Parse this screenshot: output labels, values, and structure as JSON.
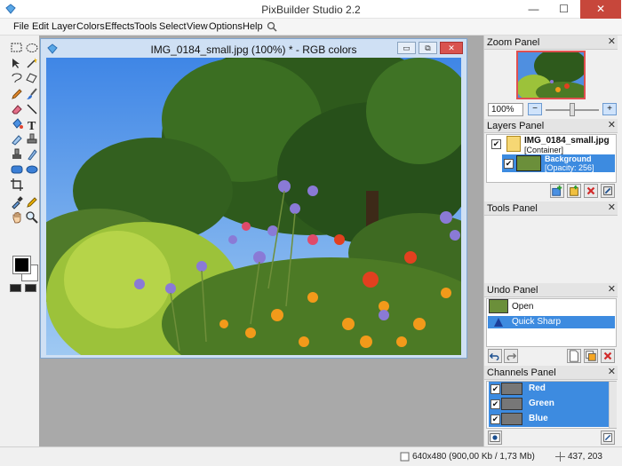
{
  "app": {
    "title": "PixBuilder Studio 2.2"
  },
  "window_controls": {
    "minimize": "—",
    "maximize": "☐",
    "close": "✕"
  },
  "menu": [
    "File",
    "Edit",
    "Layer",
    "Colors",
    "Effects",
    "Tools",
    "Select",
    "View",
    "Options",
    "Help"
  ],
  "image_window": {
    "title": "IMG_0184_small.jpg (100%) * - RGB colors",
    "buttons": {
      "restore_down": "▭",
      "restore": "⧉",
      "close": "✕"
    }
  },
  "zoom_panel": {
    "title": "Zoom Panel",
    "zoom_value": "100%",
    "minus": "−",
    "plus": "+",
    "level": 0.5
  },
  "layers_panel": {
    "title": "Layers Panel",
    "layers": [
      {
        "name": "IMG_0184_small.jpg",
        "sub": "[Container]",
        "checked": true
      },
      {
        "name": "Background",
        "sub": "[Opacity: 256]",
        "checked": true
      }
    ]
  },
  "tools_panel": {
    "title": "Tools Panel"
  },
  "undo_panel": {
    "title": "Undo Panel",
    "items": [
      "Open",
      "Quick Sharp"
    ]
  },
  "channels_panel": {
    "title": "Channels Panel",
    "channels": [
      "Red",
      "Green",
      "Blue"
    ]
  },
  "status": {
    "dimensions": "640x480 (900,00 Kb / 1,73 Mb)",
    "coords": "437, 203"
  },
  "colors": {
    "accent": "#3d8be0",
    "titlebar_close": "#c7473b",
    "workspace": "#a9a9a9"
  }
}
